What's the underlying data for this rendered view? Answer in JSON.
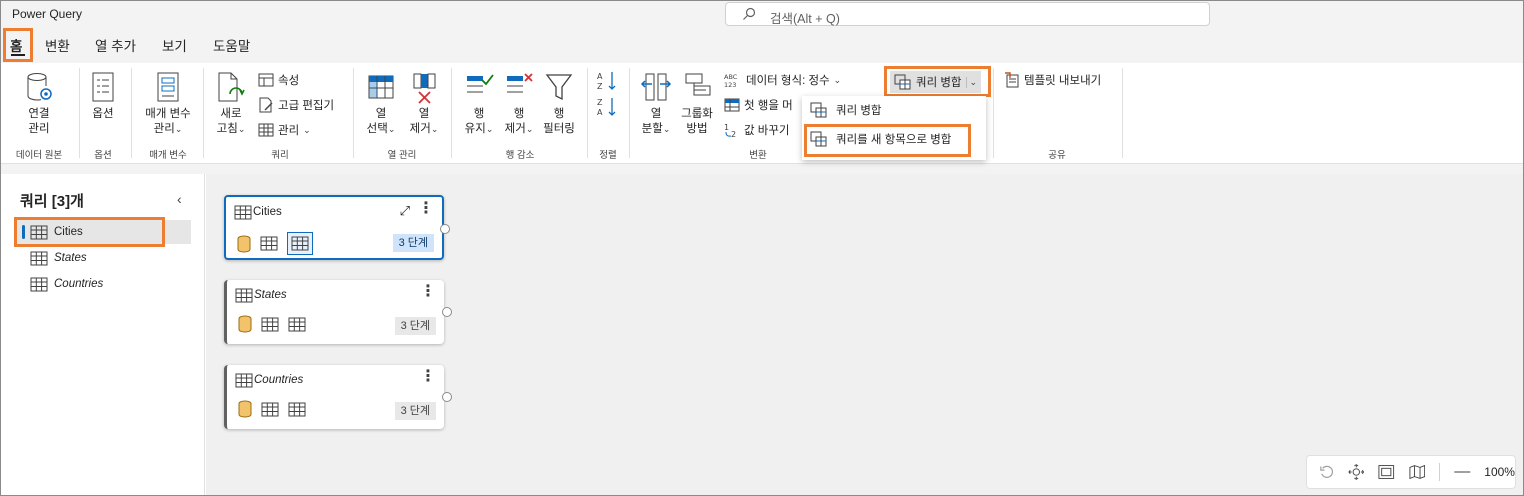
{
  "app": {
    "title": "Power Query"
  },
  "search": {
    "placeholder": "검색(Alt + Q)"
  },
  "tabs": [
    {
      "label": "홈",
      "active": true
    },
    {
      "label": "변환",
      "active": false
    },
    {
      "label": "열 추가",
      "active": false
    },
    {
      "label": "보기",
      "active": false
    },
    {
      "label": "도움말",
      "active": false
    }
  ],
  "ribbon": {
    "data_source": {
      "manage_connections": [
        "연결",
        "관리"
      ],
      "group": "데이터 원본"
    },
    "options": {
      "label": "옵션",
      "group": "옵션"
    },
    "parameters": {
      "manage": [
        "매개 변수",
        "관리"
      ],
      "group": "매개 변수"
    },
    "query": {
      "refresh": [
        "새로",
        "고침"
      ],
      "properties": "속성",
      "advanced_editor": "고급 편집기",
      "manage": "관리",
      "group": "쿼리"
    },
    "manage_columns": {
      "choose": [
        "열",
        "선택"
      ],
      "remove": [
        "열",
        "제거"
      ],
      "group": "열 관리"
    },
    "reduce_rows": {
      "keep": [
        "행",
        "유지"
      ],
      "remove": [
        "행",
        "제거"
      ],
      "filter": [
        "행",
        "필터링"
      ],
      "group": "행 감소"
    },
    "sort": {
      "group": "정렬"
    },
    "transform": {
      "split": [
        "열",
        "분할"
      ],
      "group_by": [
        "그룹화",
        "방법"
      ],
      "data_type": "데이터 형식: 정수",
      "first_row": "첫 행을 머",
      "replace": "값 바꾸기",
      "group": "변환"
    },
    "combine": {
      "merge_queries": "쿼리 병합"
    },
    "share": {
      "export_template": "템플릿 내보내기",
      "group": "공유"
    }
  },
  "merge_dropdown": {
    "items": [
      "쿼리 병합",
      "쿼리를 새 항목으로 병합"
    ]
  },
  "queries_pane": {
    "title": "쿼리 [3]개",
    "items": [
      {
        "name": "Cities",
        "selected": true
      },
      {
        "name": "States",
        "selected": false
      },
      {
        "name": "Countries",
        "selected": false
      }
    ]
  },
  "diagram": {
    "cards": [
      {
        "name": "Cities",
        "steps": "3 단계",
        "selected": true
      },
      {
        "name": "States",
        "steps": "3 단계",
        "selected": false
      },
      {
        "name": "Countries",
        "steps": "3 단계",
        "selected": false
      }
    ]
  },
  "zoom": {
    "value": "100%"
  },
  "colors": {
    "accent": "#0f6cbd",
    "highlight": "#ed7d31",
    "db_icon": "#f3c36b"
  }
}
